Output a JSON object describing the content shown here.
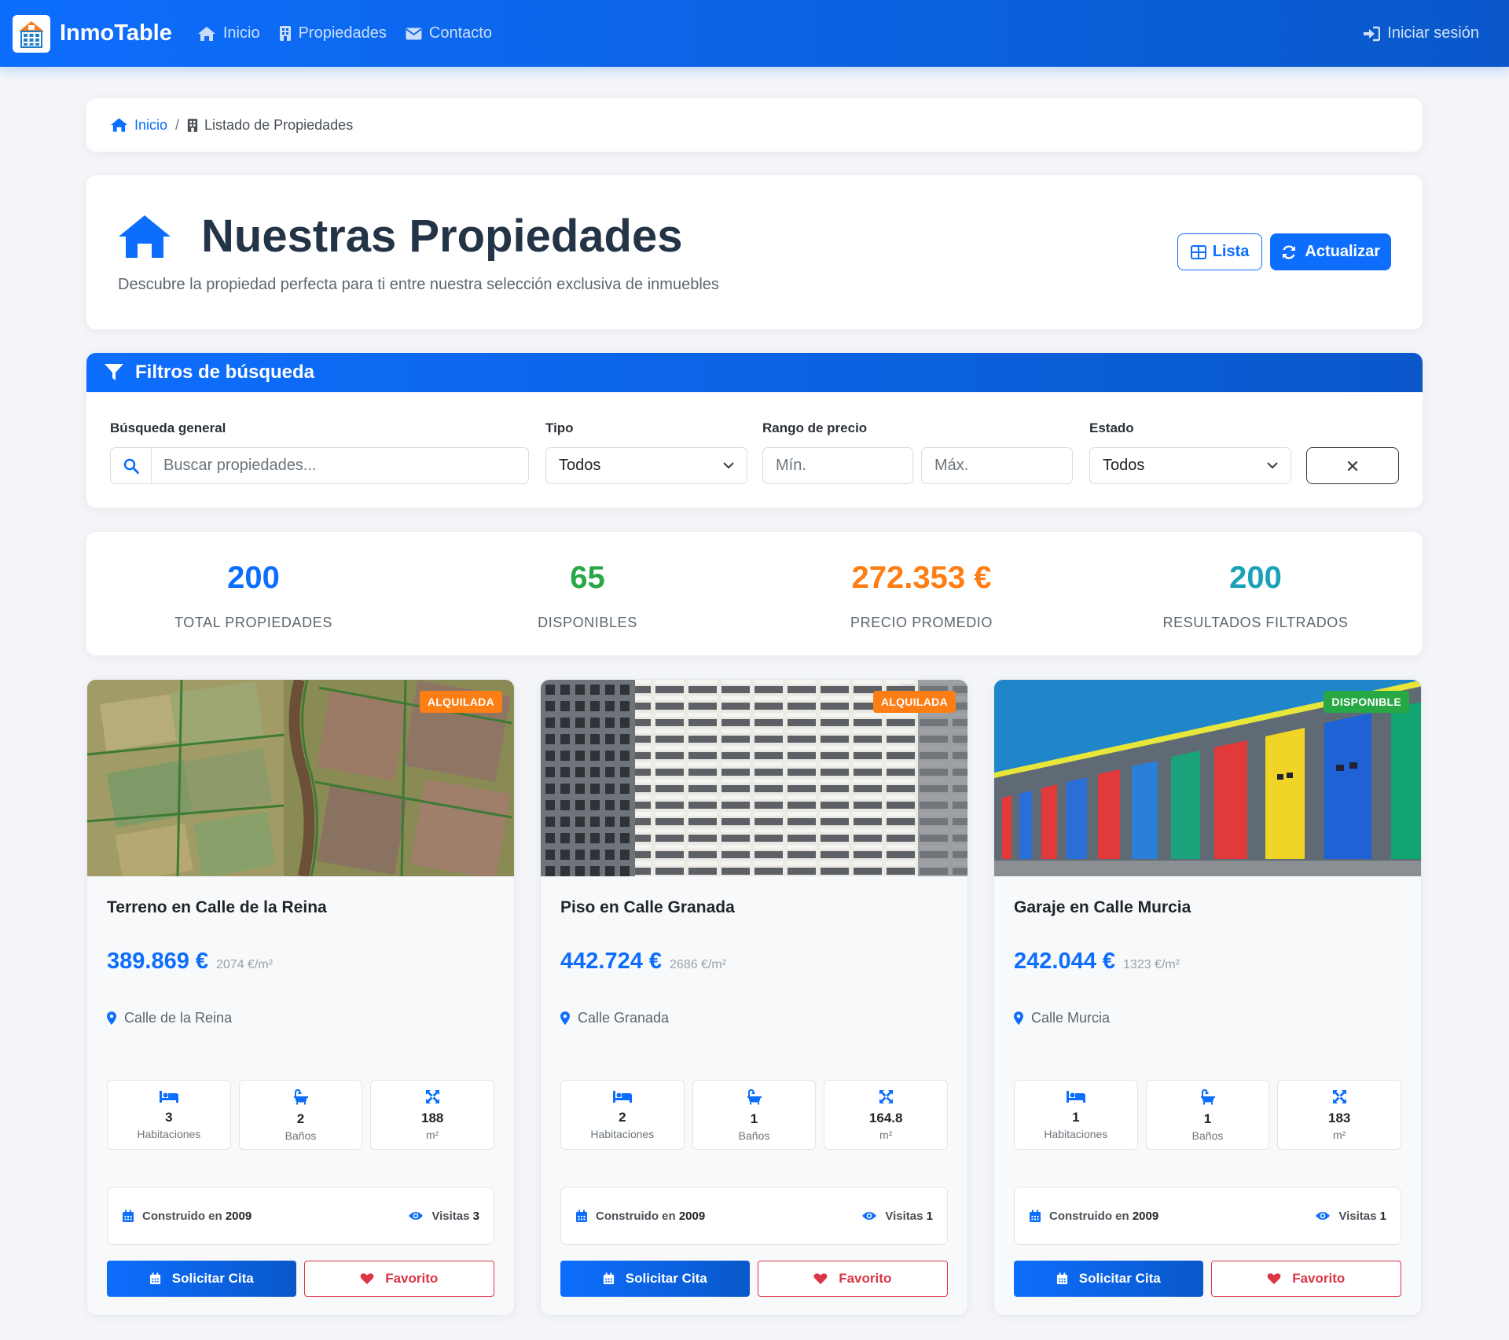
{
  "navbar": {
    "brand": "InmoTable",
    "links": [
      {
        "label": "Inicio",
        "icon": "home-icon"
      },
      {
        "label": "Propiedades",
        "icon": "building-icon"
      },
      {
        "label": "Contacto",
        "icon": "envelope-icon"
      }
    ],
    "login": "Iniciar sesión"
  },
  "breadcrumb": {
    "home": "Inicio",
    "separator": "/",
    "current": "Listado de Propiedades"
  },
  "header": {
    "title": "Nuestras Propiedades",
    "subtitle": "Descubre la propiedad perfecta para ti entre nuestra selección exclusiva de inmuebles",
    "view_button": "Lista",
    "refresh_button": "Actualizar"
  },
  "filters": {
    "title": "Filtros de búsqueda",
    "search_label": "Búsqueda general",
    "search_placeholder": "Buscar propiedades...",
    "type_label": "Tipo",
    "type_value": "Todos",
    "price_label": "Rango de precio",
    "price_min_placeholder": "Mín.",
    "price_max_placeholder": "Máx.",
    "status_label": "Estado",
    "status_value": "Todos"
  },
  "stats": [
    {
      "value": "200",
      "label": "TOTAL PROPIEDADES",
      "color": "#0d6efd"
    },
    {
      "value": "65",
      "label": "DISPONIBLES",
      "color": "#28a745"
    },
    {
      "value": "272.353 €",
      "label": "PRECIO PROMEDIO",
      "color": "#fd7e14"
    },
    {
      "value": "200",
      "label": "RESULTADOS FILTRADOS",
      "color": "#17a2b8"
    }
  ],
  "properties": [
    {
      "status": "ALQUILADA",
      "status_color": "#fd7e14",
      "title": "Terreno en Calle de la Reina",
      "price": "389.869 €",
      "price_m2": "2074 €/m²",
      "location": "Calle de la Reina",
      "rooms": "3",
      "rooms_label": "Habitaciones",
      "baths": "2",
      "baths_label": "Baños",
      "area": "188",
      "area_label": "m²",
      "built_label": "Construido en",
      "built": "2009",
      "visits_label": "Visitas",
      "visits": "3",
      "appointment": "Solicitar Cita",
      "favorite": "Favorito",
      "image": "farmland-aerial"
    },
    {
      "status": "ALQUILADA",
      "status_color": "#fd7e14",
      "title": "Piso en Calle Granada",
      "price": "442.724 €",
      "price_m2": "2686 €/m²",
      "location": "Calle Granada",
      "rooms": "2",
      "rooms_label": "Habitaciones",
      "baths": "1",
      "baths_label": "Baños",
      "area": "164.8",
      "area_label": "m²",
      "built_label": "Construido en",
      "built": "2009",
      "visits_label": "Visitas",
      "visits": "1",
      "appointment": "Solicitar Cita",
      "favorite": "Favorito",
      "image": "apartment-building"
    },
    {
      "status": "DISPONIBLE",
      "status_color": "#28a745",
      "title": "Garaje en Calle Murcia",
      "price": "242.044 €",
      "price_m2": "1323 €/m²",
      "location": "Calle Murcia",
      "rooms": "1",
      "rooms_label": "Habitaciones",
      "baths": "1",
      "baths_label": "Baños",
      "area": "183",
      "area_label": "m²",
      "built_label": "Construido en",
      "built": "2009",
      "visits_label": "Visitas",
      "visits": "1",
      "appointment": "Solicitar Cita",
      "favorite": "Favorito",
      "image": "colorful-garages"
    }
  ]
}
